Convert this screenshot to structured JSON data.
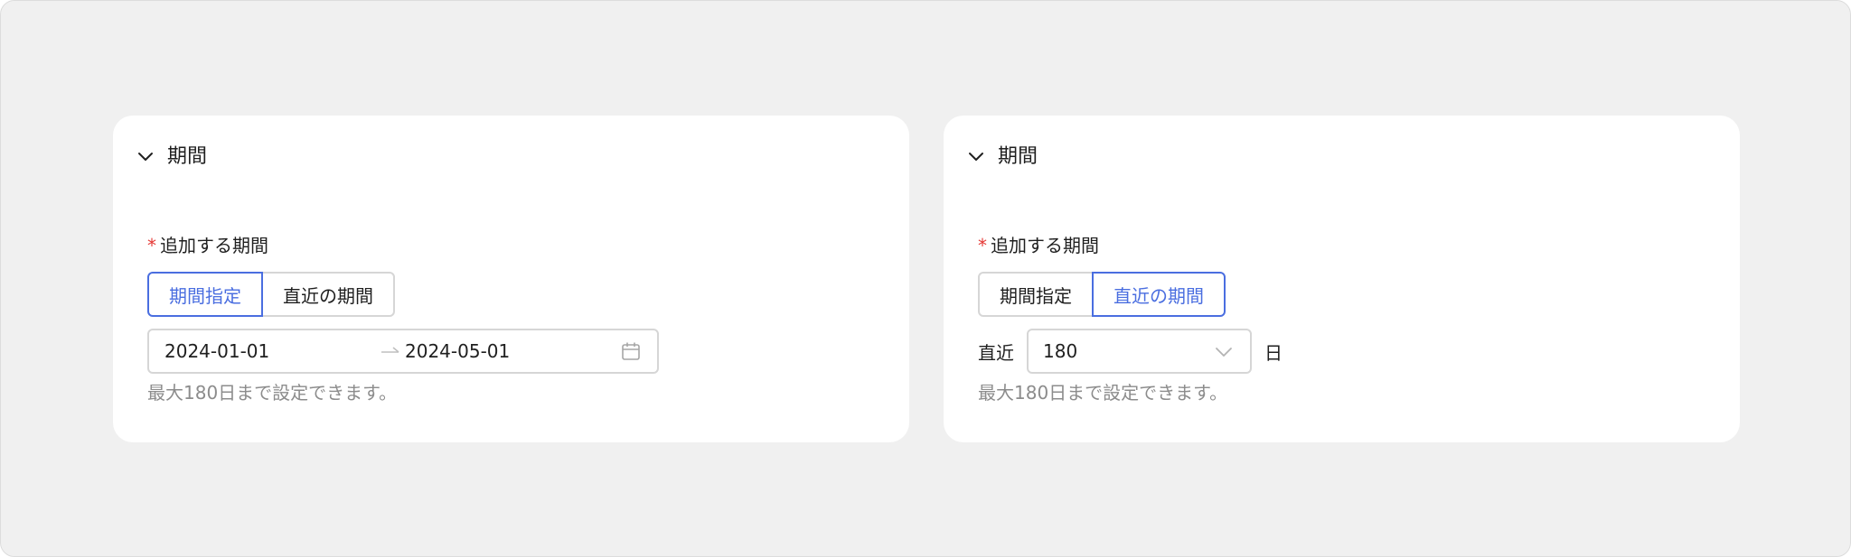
{
  "colors": {
    "accent": "#4a6ee0",
    "required": "#e53935",
    "hint": "#8c8c8c",
    "border": "#d6d6d6",
    "background": "#f0f0f0"
  },
  "cards": [
    {
      "title": "期間",
      "required_mark": "*",
      "field_label": "追加する期間",
      "tabs": [
        {
          "label": "期間指定",
          "selected": true
        },
        {
          "label": "直近の期間",
          "selected": false
        }
      ],
      "range": {
        "start": "2024-01-01",
        "end": "2024-05-01",
        "separator_icon": "arrow-right-icon",
        "picker_icon": "calendar-icon"
      },
      "hint": "最大180日まで設定できます。"
    },
    {
      "title": "期間",
      "required_mark": "*",
      "field_label": "追加する期間",
      "tabs": [
        {
          "label": "期間指定",
          "selected": false
        },
        {
          "label": "直近の期間",
          "selected": true
        }
      ],
      "recent": {
        "prefix": "直近",
        "value": "180",
        "suffix": "日",
        "dropdown_icon": "chevron-down-icon"
      },
      "hint": "最大180日まで設定できます。"
    }
  ]
}
